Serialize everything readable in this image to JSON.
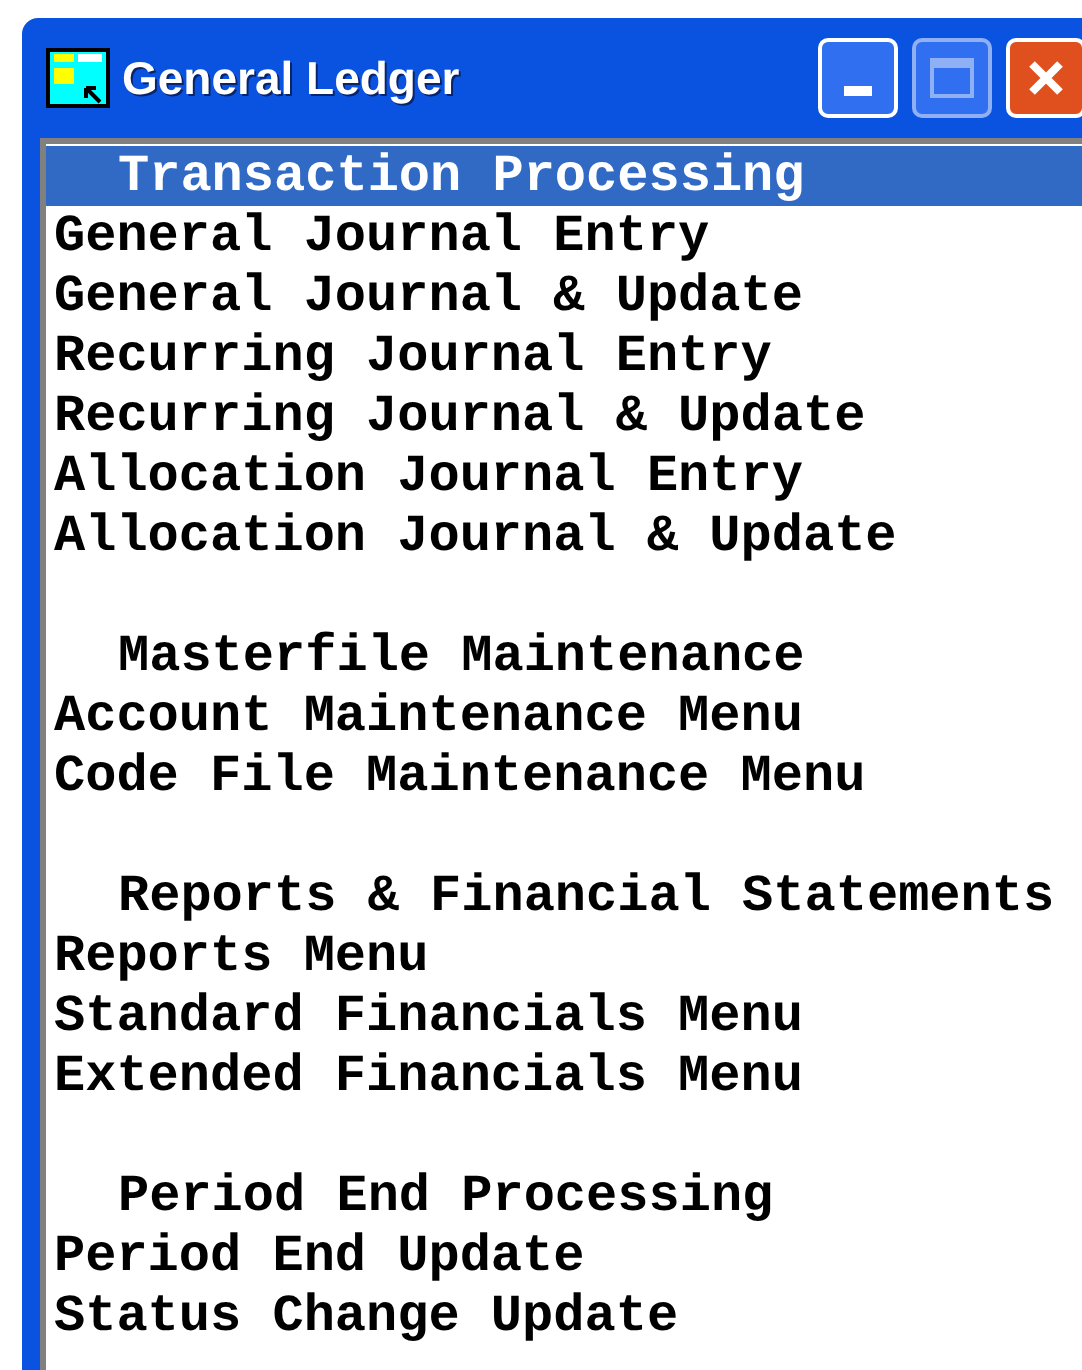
{
  "window": {
    "title": "General Ledger"
  },
  "sections": [
    {
      "heading": "Transaction Processing",
      "selected": true,
      "items": [
        {
          "label": "General Journal Entry",
          "selected": false
        },
        {
          "label": "General Journal & Update",
          "selected": false
        },
        {
          "label": "Recurring Journal Entry",
          "selected": false
        },
        {
          "label": "Recurring Journal & Update",
          "selected": false
        },
        {
          "label": "Allocation Journal Entry",
          "selected": false
        },
        {
          "label": "Allocation Journal & Update",
          "selected": false
        }
      ]
    },
    {
      "heading": "Masterfile Maintenance",
      "selected": false,
      "items": [
        {
          "label": "Account Maintenance Menu",
          "selected": false
        },
        {
          "label": "Code File Maintenance Menu",
          "selected": false
        }
      ]
    },
    {
      "heading": "Reports & Financial Statements",
      "selected": false,
      "items": [
        {
          "label": "Reports Menu",
          "selected": false
        },
        {
          "label": "Standard Financials Menu",
          "selected": false
        },
        {
          "label": "Extended Financials Menu",
          "selected": false
        }
      ]
    },
    {
      "heading": "Period End Processing",
      "selected": false,
      "items": [
        {
          "label": "Period End Update",
          "selected": false
        },
        {
          "label": "Status Change Update",
          "selected": false
        }
      ]
    }
  ]
}
